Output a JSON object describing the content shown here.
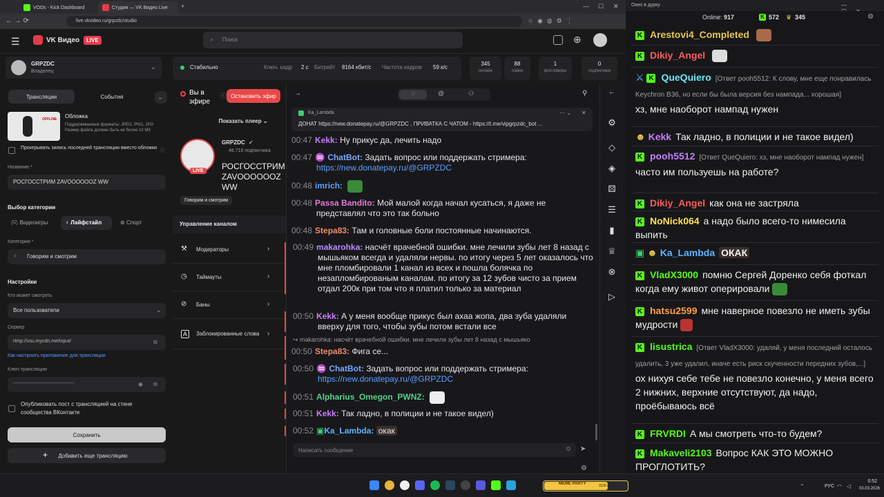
{
  "browser": {
    "tabs": [
      {
        "label": "VODs - Kick Dashboard"
      },
      {
        "label": "Студия — VK Видео Live"
      }
    ],
    "url": "live.vkvideo.ru/grpzdc/studio"
  },
  "vk": {
    "logo": "VK Видео",
    "live_badge": "LIVE",
    "search_placeholder": "Поиск"
  },
  "account": {
    "name": "GRPZDC",
    "role": "Владелец"
  },
  "left": {
    "tab_streams": "Трансляции",
    "tab_events": "События",
    "cover_title": "Обложка",
    "cover_hint": "Поддерживаемые форматы: JPEG, PNG, JPG Размер файла должен быть не более 10 Мб",
    "cover_thumb_text": "OFFLINE",
    "loop_checkbox": "Проигрывать запись последней трансляции вместо обложки",
    "name_label": "Название *",
    "name_value": "РОСГОССТРИМ ZAVOOOOOOZ WW",
    "category_section": "Выбор категории",
    "cat_games": "Видеоигры",
    "cat_lifestyle": "Лайфстайл",
    "cat_sport": "Спорт",
    "category_label": "Категория *",
    "category_value": "Говорим и смотрим",
    "settings_section": "Настройки",
    "who_label": "Кто может смотреть",
    "who_value": "Все пользователи",
    "server_label": "Сервер",
    "server_value": "rtmp://vsu.mycdn.me/input/",
    "howto_link": "Как настроить приложение для трансляции",
    "key_label": "Ключ трансляции",
    "key_value": "--------------------------------------",
    "publish_checkbox": "Опубликовать пост с трансляцией на стене сообщества ВКонтакте",
    "save_button": "Сохранить",
    "add_button": "Добавить еще трансляцию"
  },
  "status": {
    "state": "Стабильно",
    "keyframe_label": "Ключ. кадр",
    "keyframe_value": "2 с",
    "bitrate_label": "Битрейт",
    "bitrate_value": "8164 кбит/с",
    "fps_label": "Частота кадров",
    "fps_value": "59 к/с"
  },
  "stats": [
    {
      "value": "345",
      "label": "онлайн"
    },
    {
      "value": "88",
      "label": "лайки"
    },
    {
      "value": "1",
      "label": "фолловеры"
    },
    {
      "value": "0",
      "label": "подписчики"
    }
  ],
  "middle": {
    "on_air": "Вы в эфире",
    "stop_button": "Остановить эфир",
    "show_player": "Показать плеер",
    "channel": "GRPZDC",
    "subs": "48,716 подписчика",
    "stream_title": "РОСГОССТРИМ ZAVOOOOOOZ WW",
    "category_tag": "Говорим и смотрим",
    "manage": "Управление каналом",
    "rows": [
      {
        "label": "Модераторы"
      },
      {
        "label": "Таймауты"
      },
      {
        "label": "Баны"
      },
      {
        "label": "Заблокированные слова"
      }
    ]
  },
  "chat": {
    "pinned_user": "Ka_Lambda",
    "pinned_text": "ДОНАТ https://new.donatepay.ru/@GRPZDC , ПРИВАТКА С ЧАТОМ - https://t.me/vipgrpzdc_bot ...",
    "reply_preview": "makarohka: насчёт врачебной ошибки. мне лечили зубы лет 8 назад с мышьяко",
    "messages": [
      {
        "ts": "00:47",
        "nick": "Kekk:",
        "color": "#c77dff",
        "text": "Ну прикус да, лечить надо"
      },
      {
        "ts": "00:47",
        "nick": "ChatBot:",
        "color": "#7aa7ff",
        "text": "Задать вопрос или поддержать стримера:",
        "link": "https://new.donatepay.ru/@GRPZDC"
      },
      {
        "ts": "00:48",
        "nick": "imrich:",
        "color": "#5aa0ff",
        "text": ""
      },
      {
        "ts": "00:48",
        "nick": "Passa Bandito:",
        "color": "#e07ad6",
        "text": "Мой малой когда начал кусаться, я даже не представлял что это так больно"
      },
      {
        "ts": "00:48",
        "nick": "Stepa83:",
        "color": "#f08a6a",
        "text": "Там и головные боли постоянные начинаются."
      },
      {
        "ts": "00:49",
        "nick": "makarohka:",
        "color": "#b98cff",
        "text": "насчёт врачебной ошибки. мне лечили зубы лет 8 назад с мышьяком всегда и удаляли нервы. по итогу через 5 лет оказалось что мне пломбировали 1 канал из всех и пошла болячка по незапломбированым каналам. по итогу за 12 зубов чисто за прием отдал 200к при том что я платил только за материал"
      },
      {
        "ts": "00:50",
        "nick": "Kekk:",
        "color": "#c77dff",
        "text": "А у меня вообще прикус был ахаа жопа, два зуба удаляли вверху для того, чтобы зубы потом встали все"
      },
      {
        "ts": "00:50",
        "nick": "Stepa83:",
        "color": "#f08a6a",
        "text": "Фига се..."
      },
      {
        "ts": "00:50",
        "nick": "ChatBot:",
        "color": "#7aa7ff",
        "text": "Задать вопрос или поддержать стримера:",
        "link": "https://new.donatepay.ru/@GRPZDC"
      },
      {
        "ts": "00:51",
        "nick": "Alpharius_Omegon_PWNZ:",
        "color": "#4fd38a",
        "text": ""
      },
      {
        "ts": "00:51",
        "nick": "Kekk:",
        "color": "#c77dff",
        "text": "Так ладно, в полиции и не такое видел)"
      },
      {
        "ts": "00:52",
        "nick": "Ka_Lambda:",
        "color": "#5ab4ff",
        "text": "окак"
      }
    ],
    "input_placeholder": "Написать сообщение"
  },
  "kick": {
    "title": "Окно в дурку",
    "online_label": "Online:",
    "online_value": "917",
    "followers": "572",
    "viewers": "345",
    "messages": [
      {
        "nick": "Arestovi4_Completed",
        "color": "#e7c64a",
        "reply": "",
        "text": ""
      },
      {
        "nick": "Dikiy_Angel",
        "color": "#ff5a5a",
        "reply": "",
        "text": ""
      },
      {
        "nick": "QueQuiero",
        "color": "#67e8f9",
        "reply": "[Ответ pooh5512: К слову, мне еще понравилась Keychron B36, но если бы была версия без нампада... хорошая]",
        "text": "хз, мне наоборот нампад нужен"
      },
      {
        "nick": "Kekk",
        "color": "#c77dff",
        "reply": "",
        "text": "Так ладно, в полиции и не такое видел)"
      },
      {
        "nick": "pooh5512",
        "color": "#c77dff",
        "reply": "[Ответ QueQuiero: хз, мне наоборот нампад нужен]",
        "text": "часто им пользуешь на работе?"
      },
      {
        "nick": "Dikiy_Angel",
        "color": "#ff5a5a",
        "reply": "",
        "text": "как она не застряла"
      },
      {
        "nick": "NoNick064",
        "color": "#ffe14d",
        "reply": "",
        "text": "а надо было всего-то нимесила выпить"
      },
      {
        "nick": "Ka_Lambda",
        "color": "#5ab4ff",
        "reply": "",
        "text": "ОКАК"
      },
      {
        "nick": "VladX3000",
        "color": "#53fc18",
        "reply": "",
        "text": "помню Сергей Доренко себя фоткал когда ему живот оперировали"
      },
      {
        "nick": "hatsu2599",
        "color": "#ff9f43",
        "reply": "",
        "text": "мне наверное повезло не иметь зубы мудрости"
      },
      {
        "nick": "lisustrica",
        "color": "#53fc18",
        "reply": "[Ответ VladX3000: удаляй, у меня последний осталось удалить, 3 уже удалил, иначе есть риск скученности передних зубов,...]",
        "text": "ох нихуя себе тебе не повезло конечно, у меня всего 2 нижних, верхние отсутствуют, да надо, проёбываюсь всё"
      },
      {
        "nick": "FRVRDI",
        "color": "#53fc18",
        "reply": "",
        "text": "А мы смотреть что-то будем?"
      },
      {
        "nick": "Makaveli2103",
        "color": "#53fc18",
        "reply": "",
        "text": "Вопрос КАК ЭТО МОЖНО ПРОГЛОТИТЬ?"
      }
    ]
  },
  "taskbar": {
    "lang": "РУС",
    "time": "0:52",
    "date": "03.03.2026",
    "widget": "MEME PARTY",
    "widget_progress": "1100 / 1500"
  }
}
